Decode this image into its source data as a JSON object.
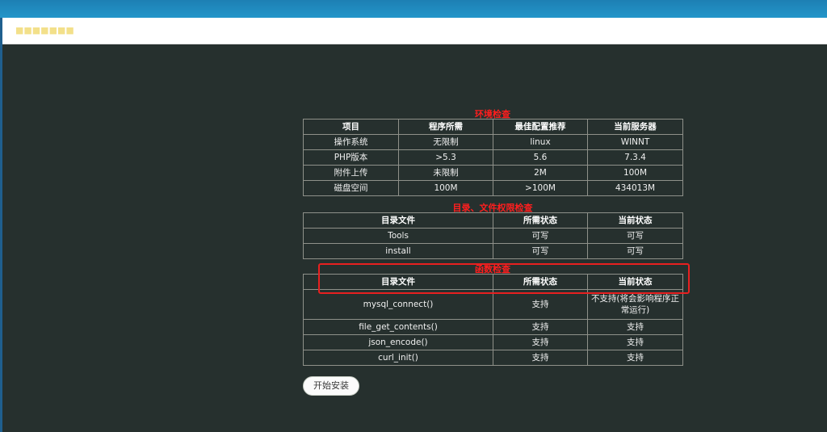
{
  "window": {
    "title": "■■■■■■■"
  },
  "env_check": {
    "title": "环境检查",
    "headers": [
      "项目",
      "程序所需",
      "最佳配置推荐",
      "当前服务器"
    ],
    "rows": [
      [
        "操作系统",
        "无限制",
        "linux",
        "WINNT"
      ],
      [
        "PHP版本",
        ">5.3",
        "5.6",
        "7.3.4"
      ],
      [
        "附件上传",
        "未限制",
        "2M",
        "100M"
      ],
      [
        "磁盘空间",
        "100M",
        ">100M",
        "434013M"
      ]
    ]
  },
  "dir_check": {
    "title": "目录、文件权限检查",
    "headers": [
      "目录文件",
      "所需状态",
      "当前状态"
    ],
    "rows": [
      [
        "Tools",
        "可写",
        "可写"
      ],
      [
        "install",
        "可写",
        "可写"
      ]
    ]
  },
  "func_check": {
    "title": "函数检查",
    "headers": [
      "目录文件",
      "所需状态",
      "当前状态"
    ],
    "rows": [
      [
        "mysql_connect()",
        "支持",
        "不支持(将会影响程序正常运行)"
      ],
      [
        "file_get_contents()",
        "支持",
        "支持"
      ],
      [
        "json_encode()",
        "支持",
        "支持"
      ],
      [
        "curl_init()",
        "支持",
        "支持"
      ]
    ]
  },
  "actions": {
    "install_label": "开始安装"
  },
  "colors": {
    "background": "#26302e",
    "section_title": "#ff1e1e",
    "highlight": "#e82020"
  }
}
